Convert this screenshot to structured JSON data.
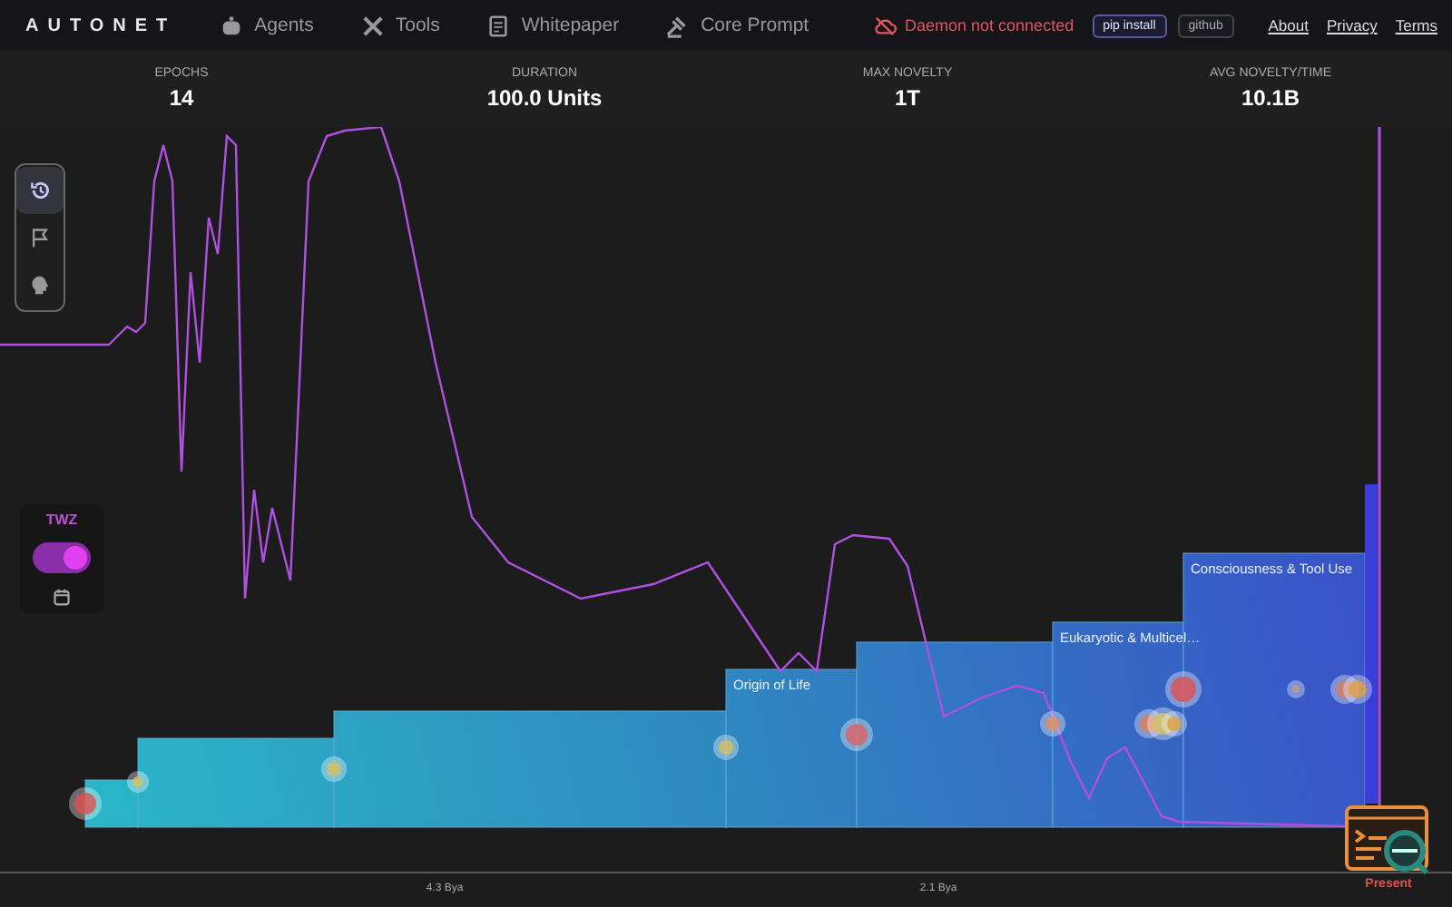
{
  "nav": {
    "logo": "AUTONET",
    "items": [
      {
        "label": "Agents"
      },
      {
        "label": "Tools"
      },
      {
        "label": "Whitepaper"
      },
      {
        "label": "Core Prompt"
      }
    ],
    "status": "Daemon not connected",
    "buttons": [
      "pip install",
      "github"
    ],
    "links": [
      "About",
      "Privacy",
      "Terms"
    ]
  },
  "stats": [
    {
      "label": "EPOCHS",
      "value": "14"
    },
    {
      "label": "DURATION",
      "value": "100.0 Units"
    },
    {
      "label": "MAX NOVELTY",
      "value": "1T"
    },
    {
      "label": "AVG NOVELTY/TIME",
      "value": "10.1B"
    }
  ],
  "tools": [
    {
      "kind": "history",
      "selected": true
    },
    {
      "kind": "flag",
      "selected": false
    },
    {
      "kind": "brain",
      "selected": false
    }
  ],
  "twz": {
    "label": "TWZ",
    "on": true
  },
  "timeline": {
    "epoch_labels": [
      "Origin of Life",
      "Eukaryotic & Multicel…",
      "Consciousness & Tool Use"
    ],
    "axis_labels": [
      "4.3 Bya",
      "2.1 Bya"
    ],
    "present": "Present"
  }
}
